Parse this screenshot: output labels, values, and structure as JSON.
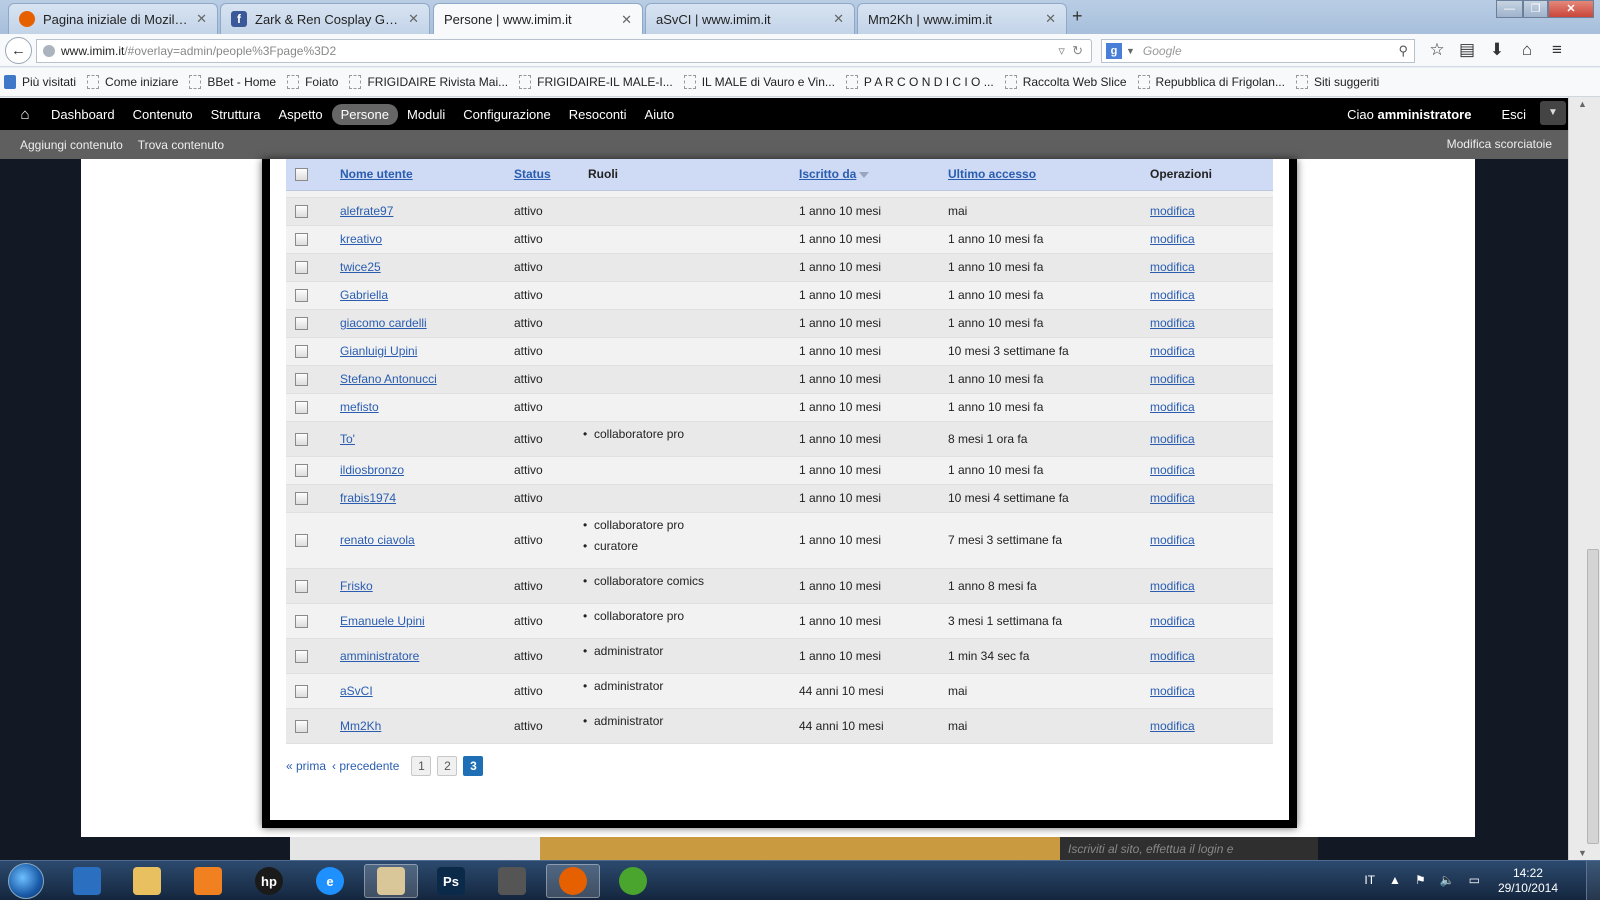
{
  "browser": {
    "tabs": [
      {
        "label": "Pagina iniziale di Mozilla Fi...",
        "icon": "firefox-icon",
        "color": "#e66000",
        "active": false
      },
      {
        "label": "Zark & Ren Cosplay Gallery",
        "icon": "facebook-icon",
        "color": "#3b5998",
        "active": false
      },
      {
        "label": "Persone | www.imim.it",
        "icon": "",
        "color": "",
        "active": true
      },
      {
        "label": "aSvCI | www.imim.it",
        "icon": "",
        "color": "",
        "active": false
      },
      {
        "label": "Mm2Kh | www.imim.it",
        "icon": "",
        "color": "",
        "active": false
      }
    ],
    "url_host": "www.imim.it",
    "url_path": "/#overlay=admin/people%3Fpage%3D2",
    "search_placeholder": "Google",
    "bookmarks": [
      "Più visitati",
      "Come iniziare",
      "BBet - Home",
      "Foiato",
      "FRIGIDAIRE Rivista Mai...",
      "FRIGIDAIRE-IL MALE-I...",
      "IL MALE di Vauro e Vin...",
      "P A R   C O N D I C I O ...",
      "Raccolta Web Slice",
      "Repubblica di Frigolan...",
      "Siti suggeriti"
    ]
  },
  "toolbar": {
    "items": [
      "Dashboard",
      "Contenuto",
      "Struttura",
      "Aspetto",
      "Persone",
      "Moduli",
      "Configurazione",
      "Resoconti",
      "Aiuto"
    ],
    "active": "Persone",
    "greeting": "Ciao ",
    "username": "amministratore",
    "logout": "Esci",
    "shortcuts": [
      "Aggiungi contenuto",
      "Trova contenuto"
    ],
    "edit_shortcuts": "Modifica scorciatoie"
  },
  "table": {
    "headers": {
      "username": "Nome utente",
      "status": "Status",
      "roles": "Ruoli",
      "member_for": "Iscritto da",
      "last_access": "Ultimo accesso",
      "operations": "Operazioni"
    },
    "rows": [
      {
        "name": "alefrate97",
        "status": "attivo",
        "roles": [],
        "member_for": "1 anno 10 mesi",
        "last_access": "mai",
        "op": "modifica"
      },
      {
        "name": "kreativo",
        "status": "attivo",
        "roles": [],
        "member_for": "1 anno 10 mesi",
        "last_access": "1 anno 10 mesi fa",
        "op": "modifica"
      },
      {
        "name": "twice25",
        "status": "attivo",
        "roles": [],
        "member_for": "1 anno 10 mesi",
        "last_access": "1 anno 10 mesi fa",
        "op": "modifica"
      },
      {
        "name": "Gabriella",
        "status": "attivo",
        "roles": [],
        "member_for": "1 anno 10 mesi",
        "last_access": "1 anno 10 mesi fa",
        "op": "modifica"
      },
      {
        "name": "giacomo cardelli",
        "status": "attivo",
        "roles": [],
        "member_for": "1 anno 10 mesi",
        "last_access": "1 anno 10 mesi fa",
        "op": "modifica"
      },
      {
        "name": "Gianluigi Upini",
        "status": "attivo",
        "roles": [],
        "member_for": "1 anno 10 mesi",
        "last_access": "10 mesi 3 settimane fa",
        "op": "modifica"
      },
      {
        "name": "Stefano Antonucci",
        "status": "attivo",
        "roles": [],
        "member_for": "1 anno 10 mesi",
        "last_access": "1 anno 10 mesi fa",
        "op": "modifica"
      },
      {
        "name": "mefisto",
        "status": "attivo",
        "roles": [],
        "member_for": "1 anno 10 mesi",
        "last_access": "1 anno 10 mesi fa",
        "op": "modifica"
      },
      {
        "name": "To'",
        "status": "attivo",
        "roles": [
          "collaboratore pro"
        ],
        "member_for": "1 anno 10 mesi",
        "last_access": "8 mesi 1 ora fa",
        "op": "modifica"
      },
      {
        "name": "ildiosbronzo",
        "status": "attivo",
        "roles": [],
        "member_for": "1 anno 10 mesi",
        "last_access": "1 anno 10 mesi fa",
        "op": "modifica"
      },
      {
        "name": "frabis1974",
        "status": "attivo",
        "roles": [],
        "member_for": "1 anno 10 mesi",
        "last_access": "10 mesi 4 settimane fa",
        "op": "modifica"
      },
      {
        "name": "renato ciavola",
        "status": "attivo",
        "roles": [
          "collaboratore pro",
          "curatore"
        ],
        "member_for": "1 anno 10 mesi",
        "last_access": "7 mesi 3 settimane fa",
        "op": "modifica"
      },
      {
        "name": "Frisko",
        "status": "attivo",
        "roles": [
          "collaboratore comics"
        ],
        "member_for": "1 anno 10 mesi",
        "last_access": "1 anno 8 mesi fa",
        "op": "modifica"
      },
      {
        "name": "Emanuele Upini",
        "status": "attivo",
        "roles": [
          "collaboratore pro"
        ],
        "member_for": "1 anno 10 mesi",
        "last_access": "3 mesi 1 settimana fa",
        "op": "modifica"
      },
      {
        "name": "amministratore",
        "status": "attivo",
        "roles": [
          "administrator"
        ],
        "member_for": "1 anno 10 mesi",
        "last_access": "1 min 34 sec fa",
        "op": "modifica"
      },
      {
        "name": "aSvCI",
        "status": "attivo",
        "roles": [
          "administrator"
        ],
        "member_for": "44 anni 10 mesi",
        "last_access": "mai",
        "op": "modifica"
      },
      {
        "name": "Mm2Kh",
        "status": "attivo",
        "roles": [
          "administrator"
        ],
        "member_for": "44 anni 10 mesi",
        "last_access": "mai",
        "op": "modifica"
      }
    ]
  },
  "pager": {
    "first": "« prima",
    "previous": "‹ precedente",
    "pages": [
      "1",
      "2",
      "3"
    ],
    "current": "3"
  },
  "background": {
    "bottom_text": "Iscriviti al sito, effettua il login e"
  },
  "taskbar": {
    "apps": [
      {
        "icon": "checkmark-app-icon",
        "label": "",
        "color": "#2a6fc0"
      },
      {
        "icon": "explorer-folder-icon",
        "label": "",
        "color": "#e8c060"
      },
      {
        "icon": "media-player-icon",
        "label": "",
        "color": "#f08020"
      },
      {
        "icon": "hp-icon",
        "label": "hp",
        "color": "#1a1a1a"
      },
      {
        "icon": "internet-explorer-icon",
        "label": "e",
        "color": "#1e90ff"
      },
      {
        "icon": "file-manager-icon",
        "label": "",
        "color": "#d9c79a"
      },
      {
        "icon": "photoshop-icon",
        "label": "Ps",
        "color": "#0b2a4a"
      },
      {
        "icon": "inkscape-icon",
        "label": "",
        "color": "#555555"
      },
      {
        "icon": "firefox-icon",
        "label": "",
        "color": "#e66000"
      },
      {
        "icon": "utorrent-icon",
        "label": "",
        "color": "#4aa52e"
      }
    ],
    "language": "IT",
    "time": "14:22",
    "date": "29/10/2014"
  },
  "colors": {
    "link": "#2a5db0",
    "header_row": "#cfdbf4",
    "pager_active": "#1e6fb6",
    "toolbar": "#000000"
  }
}
